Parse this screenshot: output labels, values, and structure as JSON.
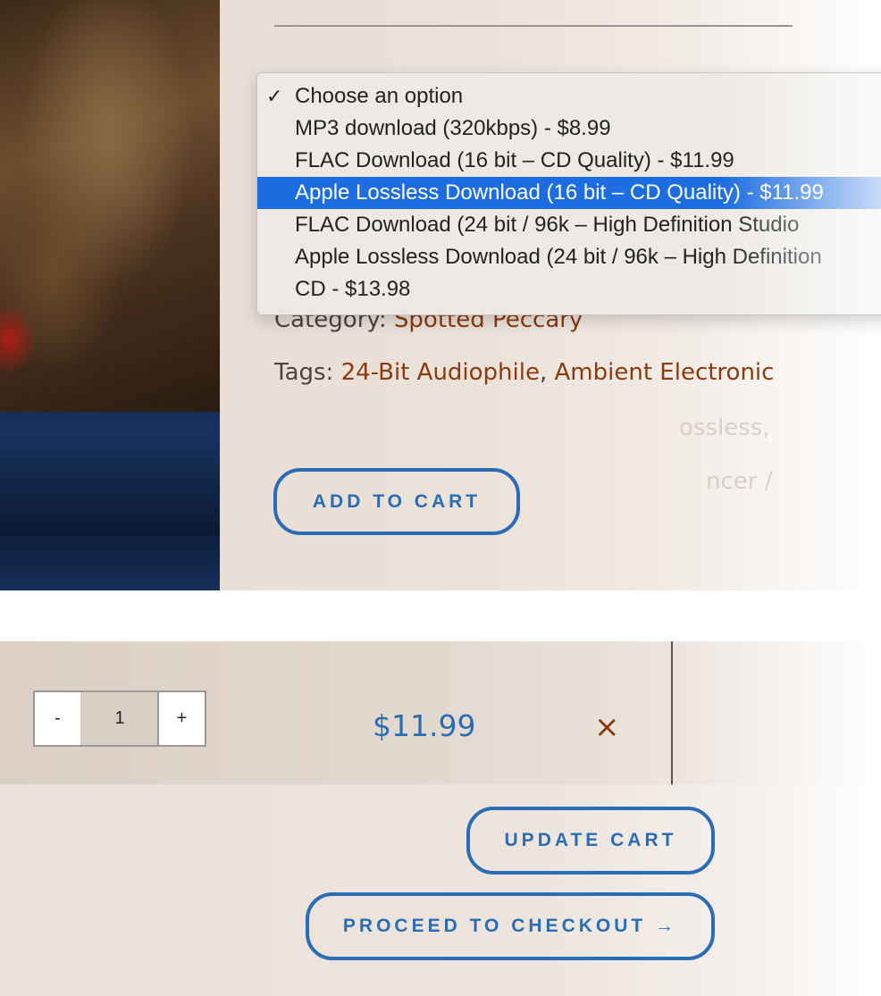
{
  "product": {
    "category_label": "Category:",
    "category_value": "Spotted Peccary",
    "tags_label": "Tags:",
    "tags": [
      "24-Bit Audiophile",
      "Ambient Electronic"
    ],
    "tags_separator": ", ",
    "faded_line_1": "ossless,",
    "faded_line_2": "ncer /",
    "add_to_cart_label": "ADD TO CART"
  },
  "variant_dropdown": {
    "selected_index": 3,
    "checked_index": 0,
    "options": [
      "Choose an option",
      "MP3 download (320kbps) - $8.99",
      "FLAC Download (16 bit – CD Quality) - $11.99",
      "Apple Lossless Download (16 bit – CD Quality) - $11.99",
      "FLAC Download (24 bit / 96k – High Definition Studio",
      "Apple Lossless Download (24 bit / 96k – High Definition",
      "CD - $13.98"
    ]
  },
  "cart": {
    "qty_minus": "-",
    "qty_value": "1",
    "qty_plus": "+",
    "line_price": "$11.99",
    "remove_symbol": "×",
    "update_cart_label": "UPDATE CART",
    "checkout_label": "PROCEED TO CHECKOUT →"
  },
  "colors": {
    "accent_blue": "#2a6db5",
    "link_brown": "#8b3a0e",
    "selection_blue": "#1d6de0"
  }
}
